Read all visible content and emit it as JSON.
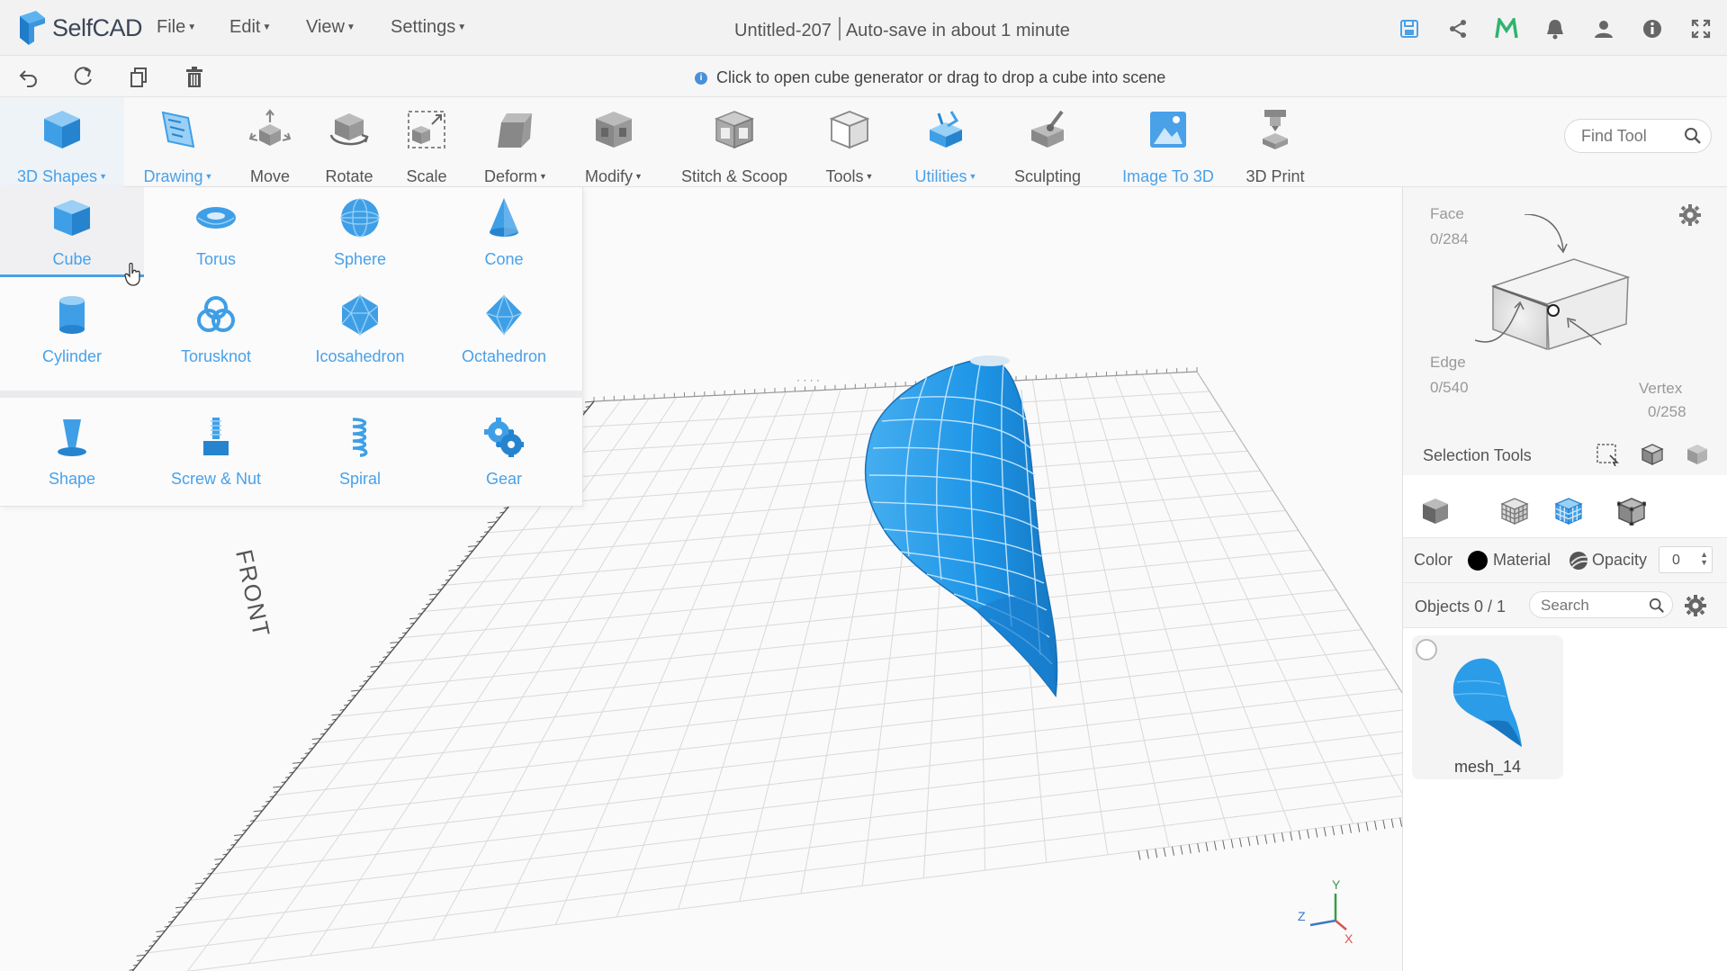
{
  "app": {
    "logo_text": "SelfCAD",
    "menus": [
      "File",
      "Edit",
      "View",
      "Settings"
    ],
    "doc_title": "Untitled-207",
    "autosave": "Auto-save in about 1 minute"
  },
  "hint": "Click to open cube generator or drag to drop a cube into scene",
  "toolbar": {
    "tools": [
      {
        "label": "3D Shapes",
        "caret": true,
        "color": "blue"
      },
      {
        "label": "Drawing",
        "caret": true,
        "color": "blue"
      },
      {
        "label": "Move"
      },
      {
        "label": "Rotate"
      },
      {
        "label": "Scale"
      },
      {
        "label": "Deform",
        "caret": true
      },
      {
        "label": "Modify",
        "caret": true
      },
      {
        "label": "Stitch & Scoop"
      },
      {
        "label": "Tools",
        "caret": true
      },
      {
        "label": "Utilities",
        "caret": true,
        "color": "blue"
      },
      {
        "label": "Sculpting"
      },
      {
        "label": "Image To 3D",
        "color": "blue"
      },
      {
        "label": "3D Print"
      }
    ],
    "find_tool_placeholder": "Find Tool"
  },
  "shapes": {
    "items": [
      "Cube",
      "Torus",
      "Sphere",
      "Cone",
      "Cylinder",
      "Torusknot",
      "Icosahedron",
      "Octahedron",
      "Shape",
      "Screw & Nut",
      "Spiral",
      "Gear"
    ],
    "selected": "Cube"
  },
  "viewport": {
    "front_label": "FRONT",
    "axes": {
      "x": "X",
      "y": "Y",
      "z": "Z"
    }
  },
  "right_panel": {
    "face_label": "Face",
    "face_count": "0/284",
    "edge_label": "Edge",
    "edge_count": "0/540",
    "vertex_label": "Vertex",
    "vertex_count": "0/258",
    "selection_tools": "Selection Tools",
    "color_label": "Color",
    "color_value": "#000000",
    "material_label": "Material",
    "opacity_label": "Opacity",
    "opacity_value": "0",
    "objects_label": "Objects 0 / 1",
    "search_placeholder": "Search",
    "object_name": "mesh_14"
  },
  "colors": {
    "accent": "#4aa1e8",
    "mesh": "#2b9de8"
  }
}
